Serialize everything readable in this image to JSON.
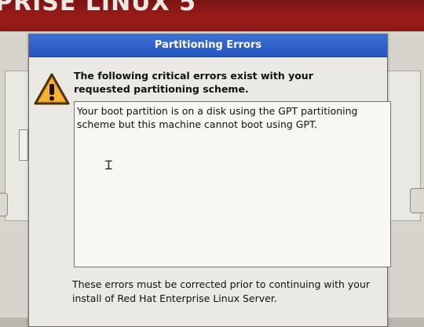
{
  "banner": {
    "text": "PRISE LINUX 5"
  },
  "dialog": {
    "title": "Partitioning Errors",
    "heading": "The following critical errors exist with your requested partitioning scheme.",
    "errors": "Your boot partition is on a disk using the GPT partitioning scheme but this machine cannot boot using GPT.",
    "footer": "These errors must be corrected prior to continuing with your install of Red Hat Enterprise Linux Server.",
    "icon": "warning-icon"
  },
  "colors": {
    "banner": "#9c1d1a",
    "titlebar": "#2d5fc8",
    "warning_fill": "#f0a21c"
  }
}
